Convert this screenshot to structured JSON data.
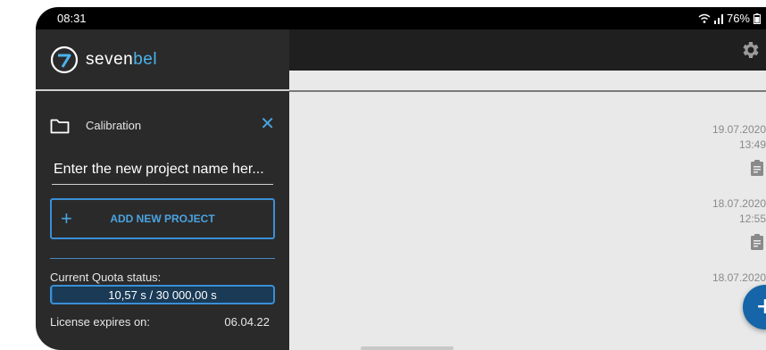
{
  "status_bar": {
    "time": "08:31",
    "battery": "76%",
    "icons": [
      "wifi-icon",
      "signal-icon",
      "battery-icon"
    ]
  },
  "app_bar": {
    "settings_icon": "gear-icon"
  },
  "drawer": {
    "brand_prefix": "seven",
    "brand_suffix": "bel",
    "project_label": "Calibration",
    "close_icon": "close-icon",
    "new_project_placeholder": "Enter the new project name her...",
    "add_project_label": "ADD NEW PROJECT",
    "quota_label": "Current Quota status:",
    "quota_value": "10,57 s / 30 000,00 s",
    "quota_fraction": 0.00035,
    "license_label": "License expires on:",
    "license_date": "06.04.22"
  },
  "list": {
    "entries": [
      {
        "date": "19.07.2020",
        "time": "13:49"
      },
      {
        "date": "18.07.2020",
        "time": "12:55"
      },
      {
        "date": "18.07.2020",
        "time": ""
      }
    ]
  },
  "fab": {
    "label": "+"
  },
  "colors": {
    "accent": "#4aa3e0",
    "drawer_bg": "#2a2a2a",
    "appbar_bg": "#1f1f1f",
    "fab_bg": "#1565a8"
  }
}
